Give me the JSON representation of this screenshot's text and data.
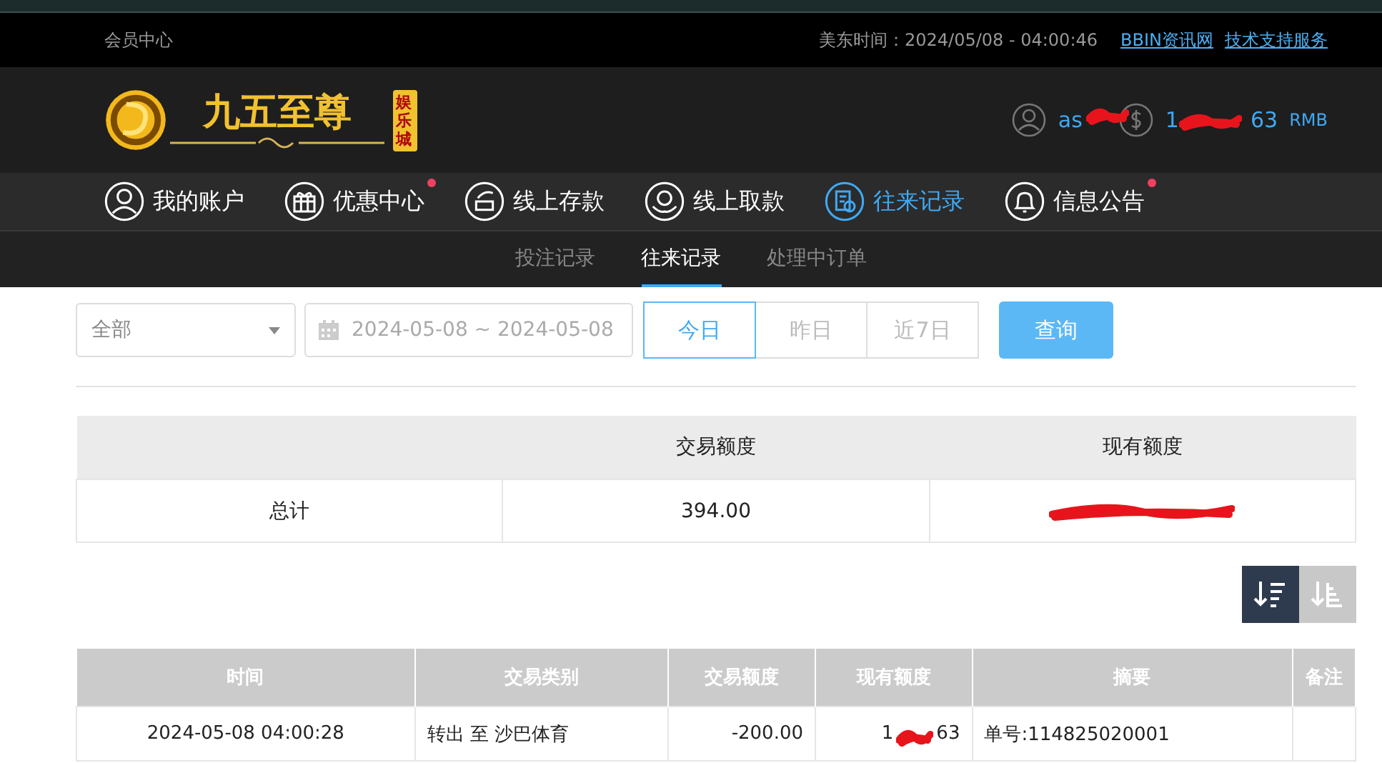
{
  "top_bar": {
    "title": "会员中心",
    "time": "美东时间：2024/05/08 - 04:00:46",
    "links": [
      "BBIN资讯网",
      "技术支持服务"
    ]
  },
  "header": {
    "brand": "九五至尊",
    "brand_badge": "娱乐城",
    "user": {
      "name": "as",
      "redacted": true
    },
    "balance": {
      "start": "1",
      "end": "63",
      "currency": "RMB",
      "redacted": true
    }
  },
  "nav": [
    {
      "label": "我的账户",
      "kind": "user",
      "selected": false,
      "dot": false
    },
    {
      "label": "优惠中心",
      "kind": "gift",
      "selected": false,
      "dot": true
    },
    {
      "label": "线上存款",
      "kind": "deposit",
      "selected": false,
      "dot": false
    },
    {
      "label": "线上取款",
      "kind": "withdraw",
      "selected": false,
      "dot": false
    },
    {
      "label": "往来记录",
      "kind": "record",
      "selected": true,
      "dot": false
    },
    {
      "label": "信息公告",
      "kind": "bell",
      "selected": false,
      "dot": true
    }
  ],
  "sub_tabs": [
    {
      "label": "投注记录",
      "selected": false
    },
    {
      "label": "往来记录",
      "selected": true
    },
    {
      "label": "处理中订单",
      "selected": false
    }
  ],
  "filters": {
    "type_select": "全部",
    "date_range": "2024-05-08 ~ 2024-05-08",
    "ranges": [
      {
        "label": "今日",
        "selected": true
      },
      {
        "label": "昨日",
        "selected": false
      },
      {
        "label": "近7日",
        "selected": false
      }
    ],
    "query_button": "查询"
  },
  "summary": {
    "columns": [
      "交易额度",
      "现有额度"
    ],
    "row": {
      "label": "总计",
      "amount": "394.00",
      "balance_redacted": true
    }
  },
  "sort_buttons": [
    {
      "kind": "desc",
      "selected": true
    },
    {
      "kind": "asc",
      "selected": false
    }
  ],
  "table": {
    "columns": [
      "时间",
      "交易类别",
      "交易额度",
      "现有额度",
      "摘要",
      "备注"
    ],
    "rows": [
      {
        "time": "2024-05-08 04:00:28",
        "type": "转出 至 沙巴体育",
        "amount": "-200.00",
        "balance_start": "1",
        "balance_end": "63",
        "balance_redacted": true,
        "summary": "单号:114825020001"
      }
    ]
  }
}
